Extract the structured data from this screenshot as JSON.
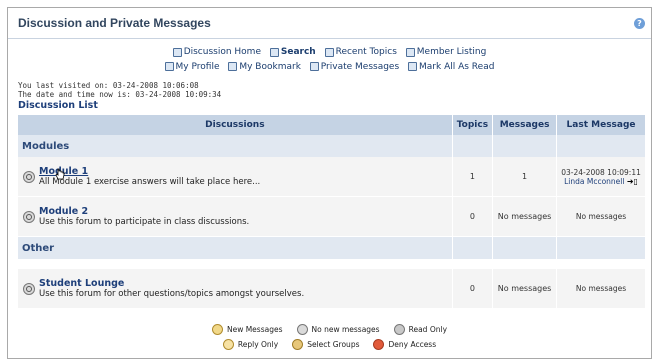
{
  "header": {
    "title": "Discussion and Private Messages",
    "help_icon": "help-icon"
  },
  "nav": {
    "discussion_home": "Discussion Home",
    "search": "Search",
    "recent_topics": "Recent Topics",
    "member_listing": "Member Listing",
    "my_profile": "My Profile",
    "my_bookmark": "My Bookmark",
    "private_messages": "Private Messages",
    "mark_all_read": "Mark All As Read"
  },
  "visit": {
    "last_visited": "You last visited on: 03-24-2008 10:06:08",
    "now": "The date and time now is: 03-24-2008 10:09:34"
  },
  "discussion_list": "Discussion List",
  "table": {
    "headers": {
      "discussions": "Discussions",
      "topics": "Topics",
      "messages": "Messages",
      "last_message": "Last Message"
    },
    "categories": [
      {
        "name": "Modules",
        "forums": [
          {
            "name": "Module 1",
            "desc": "All Module 1 exercise answers will take place here...",
            "topics": "1",
            "messages": "1",
            "last_date": "03-24-2008 10:09:11",
            "last_user": "Linda Mcconnell"
          },
          {
            "name": "Module 2",
            "desc": "Use this forum to participate in class discussions.",
            "topics": "0",
            "messages": "No messages",
            "last_none": "No messages"
          }
        ]
      },
      {
        "name": "Other",
        "forums": [
          {
            "name": "Student Lounge",
            "desc": "Use this forum for other questions/topics amongst yourselves.",
            "topics": "0",
            "messages": "No messages",
            "last_none": "No messages"
          }
        ]
      }
    ]
  },
  "legend": {
    "new_messages": "New Messages",
    "no_new_messages": "No new messages",
    "read_only": "Read Only",
    "reply_only": "Reply Only",
    "select_groups": "Select Groups",
    "deny_access": "Deny Access"
  }
}
